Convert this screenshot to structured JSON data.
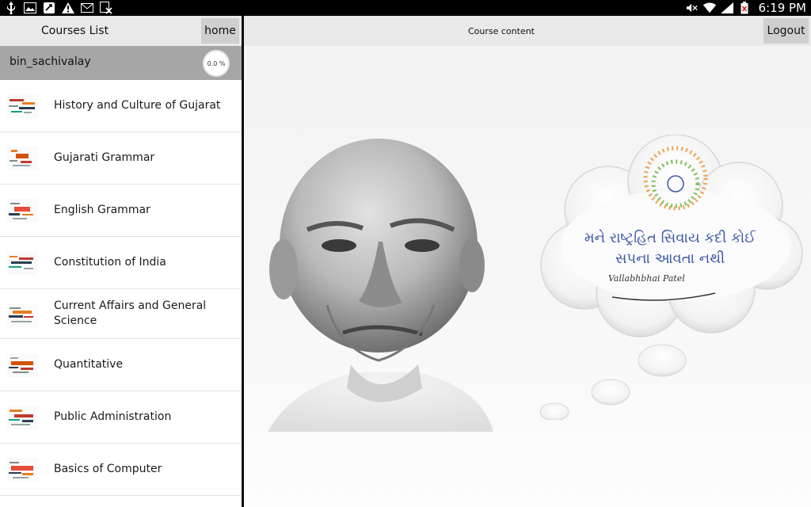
{
  "status_bar": {
    "time": "6:19 PM",
    "left_icons": [
      "usb-icon",
      "image-icon",
      "sync-icon",
      "warning-icon",
      "email-icon",
      "excel-icon"
    ],
    "right_icons": [
      "mute-icon",
      "wifi-icon",
      "signal-icon",
      "battery-icon"
    ]
  },
  "left_panel": {
    "title": "Courses List",
    "home_label": "home",
    "user": {
      "name": "bin_sachivalay",
      "progress_text": "0.0 %"
    },
    "courses": [
      {
        "label": "History and Culture of Gujarat",
        "thumb": "thumb-history-icon"
      },
      {
        "label": "Gujarati Grammar",
        "thumb": "thumb-gujarati-icon"
      },
      {
        "label": "English Grammar",
        "thumb": "thumb-english-icon"
      },
      {
        "label": "Constitution of India",
        "thumb": "thumb-constitution-icon"
      },
      {
        "label": "Current Affairs and General Science",
        "thumb": "thumb-current-affairs-icon"
      },
      {
        "label": "Quantitative",
        "thumb": "thumb-quantitative-icon"
      },
      {
        "label": "Public Administration",
        "thumb": "thumb-public-admin-icon"
      },
      {
        "label": "Basics of Computer",
        "thumb": "thumb-computer-icon"
      }
    ]
  },
  "right_panel": {
    "title": "Course content",
    "logout_label": "Logout",
    "quote_line1": "મને રાષ્ટ્રહિત સિવાય કદી કોઈ",
    "quote_line2": "સપના આવતા નથી",
    "signature": "Vallabhbhai Patel"
  },
  "colors": {
    "header_bg": "#e9e9e9",
    "user_row_bg": "#a6a6a6",
    "button_bg": "#cfcfcf",
    "quote_text": "#3e59a6"
  }
}
